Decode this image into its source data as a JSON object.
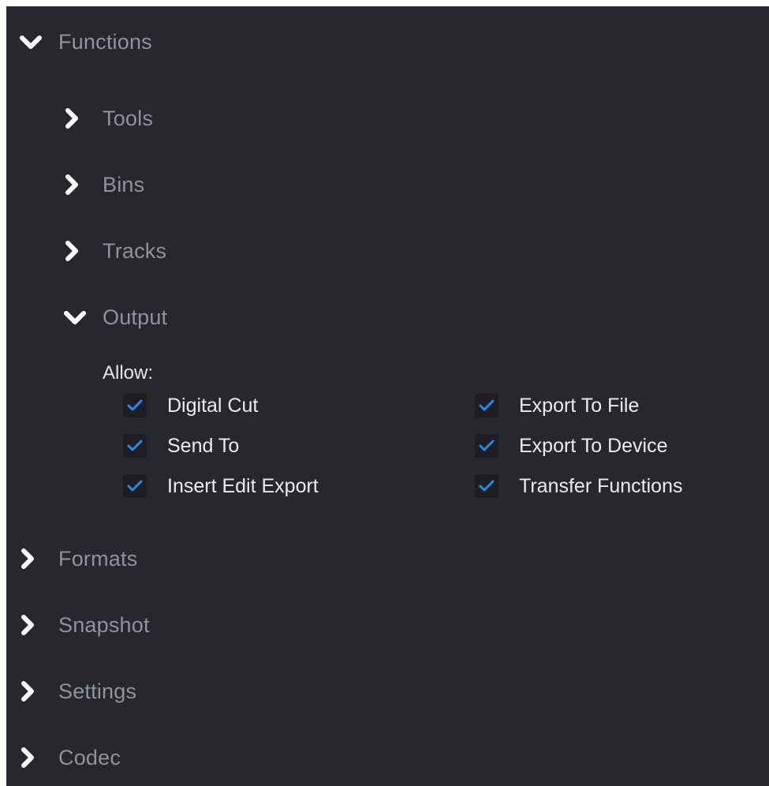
{
  "tree": {
    "functions": {
      "label": "Functions",
      "expanded": true
    },
    "tools": {
      "label": "Tools",
      "expanded": false
    },
    "bins": {
      "label": "Bins",
      "expanded": false
    },
    "tracks": {
      "label": "Tracks",
      "expanded": false
    },
    "output": {
      "label": "Output",
      "expanded": true
    },
    "formats": {
      "label": "Formats",
      "expanded": false
    },
    "snapshot": {
      "label": "Snapshot",
      "expanded": false
    },
    "settings": {
      "label": "Settings",
      "expanded": false
    },
    "codec": {
      "label": "Codec",
      "expanded": false
    }
  },
  "output_options": {
    "allow_label": "Allow:",
    "items": [
      {
        "label": "Digital Cut",
        "checked": true
      },
      {
        "label": "Send To",
        "checked": true
      },
      {
        "label": "Insert Edit Export",
        "checked": true
      },
      {
        "label": "Export To File",
        "checked": true
      },
      {
        "label": "Export To Device",
        "checked": true
      },
      {
        "label": "Transfer Functions",
        "checked": true
      }
    ]
  },
  "colors": {
    "panel_background": "#27272e",
    "tree_label": "#8f939f",
    "option_label": "#ececf0",
    "checkmark": "#1e8ff0",
    "checkbox_background": "#1d1d23"
  },
  "icons": {
    "expanded": "chevron-down-icon",
    "collapsed": "chevron-right-icon",
    "checked": "checkmark-icon"
  }
}
